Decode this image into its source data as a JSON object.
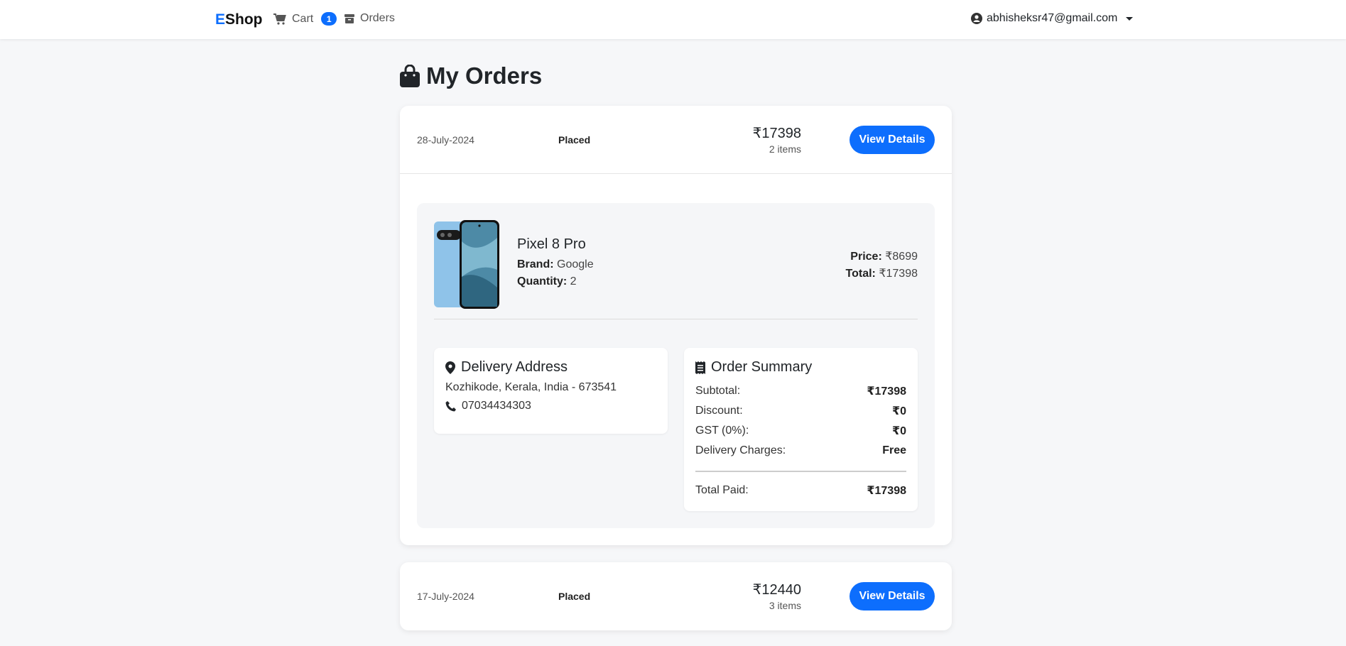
{
  "navbar": {
    "brand_e": "E",
    "brand_rest": "Shop",
    "cart_label": "Cart",
    "cart_count": "1",
    "orders_label": "Orders",
    "user_email": "abhisheksr47@gmail.com"
  },
  "page": {
    "title": "My Orders"
  },
  "orders": [
    {
      "date": "28-July-2024",
      "status": "Placed",
      "amount": "₹17398",
      "items_count": "2 items",
      "button_label": "View Details",
      "product": {
        "name": "Pixel 8 Pro",
        "brand_label": "Brand:",
        "brand": "Google",
        "quantity_label": "Quantity:",
        "quantity": "2",
        "price_label": "Price:",
        "price": "₹8699",
        "total_label": "Total:",
        "total": "₹17398"
      },
      "delivery": {
        "title": "Delivery Address",
        "address": "Kozhikode, Kerala, India - 673541",
        "phone": "07034434303"
      },
      "summary": {
        "title": "Order Summary",
        "subtotal_label": "Subtotal:",
        "subtotal": "₹17398",
        "discount_label": "Discount:",
        "discount": "₹0",
        "gst_label": "GST (0%):",
        "gst": "₹0",
        "delivery_label": "Delivery Charges:",
        "delivery": "Free",
        "total_label": "Total Paid:",
        "total": "₹17398"
      }
    },
    {
      "date": "17-July-2024",
      "status": "Placed",
      "amount": "₹12440",
      "items_count": "3 items",
      "button_label": "View Details"
    }
  ],
  "colors": {
    "primary": "#0d6efd",
    "background": "#f6f7f9"
  },
  "icons": [
    "cart-icon",
    "box-icon",
    "user-circle-icon",
    "shopping-bag-icon",
    "map-pin-icon",
    "phone-icon",
    "receipt-icon"
  ]
}
